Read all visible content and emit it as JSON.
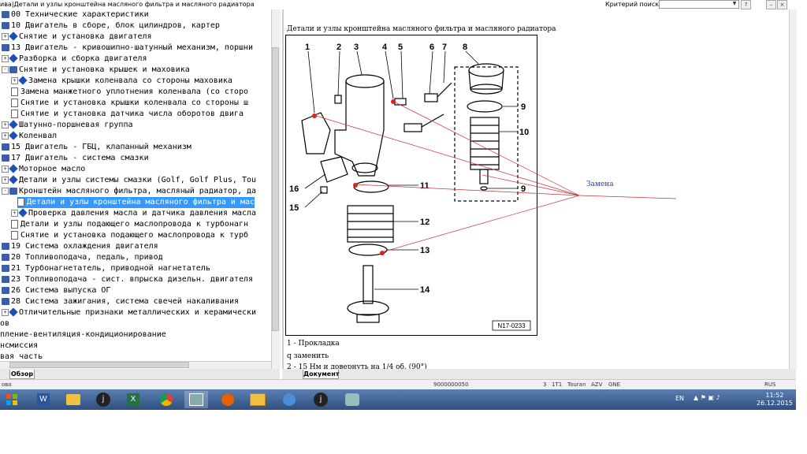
{
  "window": {
    "title": "ива|Детали и узлы кронштейна масляного фильтра и масляного радиатора",
    "search_label": "Критерий поиска:",
    "search_value": ""
  },
  "tree": {
    "items": [
      {
        "label": "00 Технические характеристики",
        "indent": 0,
        "icon": "book",
        "expander": ""
      },
      {
        "label": "10 Двигатель в сборе, блок цилиндров, картер",
        "indent": 0,
        "icon": "book",
        "expander": ""
      },
      {
        "label": "Снятие и установка двигателя",
        "indent": 0,
        "icon": "diamond",
        "expander": "+"
      },
      {
        "label": "13 Двигатель - кривошипно-шатунный механизм, поршни",
        "indent": 0,
        "icon": "book",
        "expander": ""
      },
      {
        "label": "Разборка и сборка двигателя",
        "indent": 0,
        "icon": "diamond",
        "expander": "+"
      },
      {
        "label": "Снятие и установка крышек и маховика",
        "indent": 0,
        "icon": "book",
        "expander": "-"
      },
      {
        "label": "Замена крышки коленвала со стороны маховика",
        "indent": 1,
        "icon": "diamond",
        "expander": "+"
      },
      {
        "label": "Замена манжетного уплотнения коленвала (со сторо",
        "indent": 1,
        "icon": "doc",
        "expander": ""
      },
      {
        "label": "Снятие и установка крышки коленвала со стороны ш",
        "indent": 1,
        "icon": "doc",
        "expander": ""
      },
      {
        "label": "Снятие и установка датчика числа оборотов двига",
        "indent": 1,
        "icon": "doc",
        "expander": ""
      },
      {
        "label": "Шатунно-поршневая группа",
        "indent": 0,
        "icon": "diamond",
        "expander": "+"
      },
      {
        "label": "Коленвал",
        "indent": 0,
        "icon": "diamond",
        "expander": "+"
      },
      {
        "label": "15 Двигатель - ГБЦ, клапанный механизм",
        "indent": 0,
        "icon": "book",
        "expander": ""
      },
      {
        "label": "17 Двигатель - система смазки",
        "indent": 0,
        "icon": "book",
        "expander": ""
      },
      {
        "label": "Моторное масло",
        "indent": 0,
        "icon": "diamond",
        "expander": "+"
      },
      {
        "label": "Детали и узлы системы смазки (Golf, Golf Plus, Tou",
        "indent": 0,
        "icon": "diamond",
        "expander": "+"
      },
      {
        "label": "Кронштейн масляного фильтра, масляный радиатор, да",
        "indent": 0,
        "icon": "book",
        "expander": "-"
      },
      {
        "label": "Детали и узлы кронштейна масляного фильтра и мас",
        "indent": 1,
        "icon": "doc",
        "expander": "",
        "selected": true
      },
      {
        "label": "Проверка давления масла и датчика давления масла",
        "indent": 1,
        "icon": "diamond",
        "expander": "+"
      },
      {
        "label": "Детали и узлы подающего маслопровода к турбонагн",
        "indent": 1,
        "icon": "doc",
        "expander": ""
      },
      {
        "label": "Снятие и установка подающего маслопровода к турб",
        "indent": 1,
        "icon": "doc",
        "expander": ""
      },
      {
        "label": "19 Система охлаждения двигателя",
        "indent": 0,
        "icon": "book",
        "expander": ""
      },
      {
        "label": "20 Топливоподача, педаль, привод",
        "indent": 0,
        "icon": "book",
        "expander": ""
      },
      {
        "label": "21 Турбонагнетатель, приводной нагнетатель",
        "indent": 0,
        "icon": "book",
        "expander": ""
      },
      {
        "label": "23 Топливоподача - сист. впрыска дизельн. двигателя",
        "indent": 0,
        "icon": "book",
        "expander": ""
      },
      {
        "label": "26 Система выпуска ОГ",
        "indent": 0,
        "icon": "book",
        "expander": ""
      },
      {
        "label": "28 Система зажигания, система свечей накаливания",
        "indent": 0,
        "icon": "book",
        "expander": ""
      },
      {
        "label": "Отличительные признаки металлических и керамически",
        "indent": 0,
        "icon": "diamond",
        "expander": "+"
      },
      {
        "label": "зов",
        "indent": -1,
        "icon": "",
        "expander": ""
      },
      {
        "label": "опление-вентиляция-кондиционирование",
        "indent": -1,
        "icon": "",
        "expander": ""
      },
      {
        "label": "ансмиссия",
        "indent": -1,
        "icon": "",
        "expander": ""
      },
      {
        "label": "овая часть",
        "indent": -1,
        "icon": "",
        "expander": ""
      }
    ]
  },
  "tabs": {
    "left": "Обзор",
    "right": "Документ"
  },
  "document": {
    "title": "Детали и узлы кронштейна масляного фильтра и масляного радиатора",
    "figure_code": "N17-0233",
    "callout_numbers": [
      "1",
      "2",
      "3",
      "4",
      "5",
      "6",
      "7",
      "8",
      "9",
      "10",
      "11",
      "9",
      "12",
      "13",
      "14",
      "15",
      "16"
    ],
    "annotation": "Замена",
    "caption_1": "1 - Прокладка",
    "caption_2": "q  заменить",
    "caption_3": "2 - 15 Нм и довернуть на 1/4 об. (90°)"
  },
  "status": {
    "left": "ово",
    "code": "9000000050",
    "f1": "3",
    "f2": "1T1",
    "f3": "Touran",
    "f4": "AZV",
    "f5": "GNE",
    "lang": "RUS"
  },
  "taskbar": {
    "apps": [
      "start-icon",
      "word-icon",
      "folder-icon",
      "joxi-icon",
      "excel-icon",
      "chrome-icon",
      "elsa-icon",
      "firefox-icon",
      "explorer-icon",
      "speaker-icon",
      "joxi2-icon",
      "image-icon"
    ],
    "lang": "EN",
    "time": "11:52",
    "date": "26.12.2015"
  },
  "colors": {
    "selection": "#3399ff",
    "taskbar": "#2f4f80",
    "annotation": "#2040a0",
    "leader_lines": "#cc3333"
  }
}
